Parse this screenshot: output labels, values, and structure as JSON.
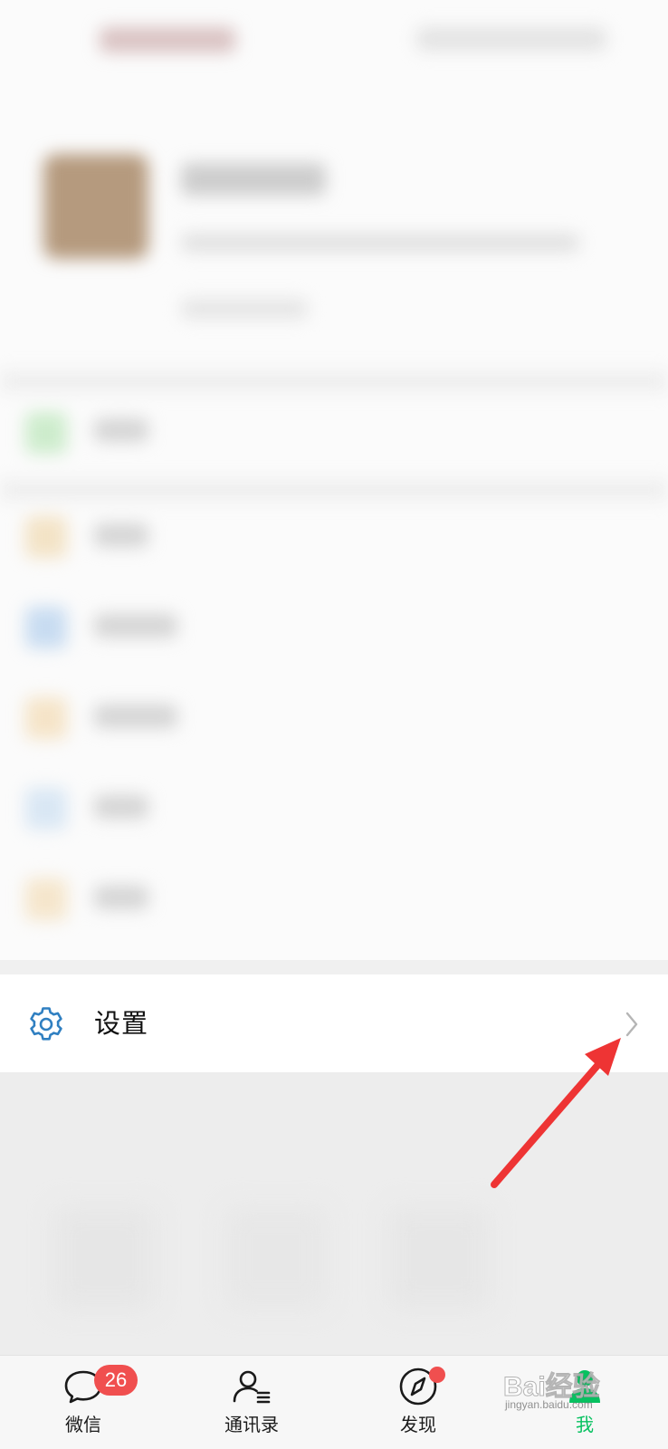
{
  "settings_item": {
    "label": "设置",
    "icon": "gear-icon",
    "trailing_icon": "chevron-right-icon",
    "icon_color": "#2f7fc1"
  },
  "tabbar": {
    "tabs": [
      {
        "label": "微信",
        "icon": "chat-bubble-icon",
        "badge": "26"
      },
      {
        "label": "通讯录",
        "icon": "contacts-icon"
      },
      {
        "label": "发现",
        "icon": "compass-icon",
        "has_dot": true
      },
      {
        "label": "我",
        "icon": "person-icon",
        "active": true
      }
    ],
    "active_color": "#07c160",
    "badge_color": "#f04f4f"
  },
  "watermark": {
    "text": "Bai经验",
    "url": "jingyan.baidu.com"
  },
  "annotation": {
    "color": "#ee3434"
  }
}
